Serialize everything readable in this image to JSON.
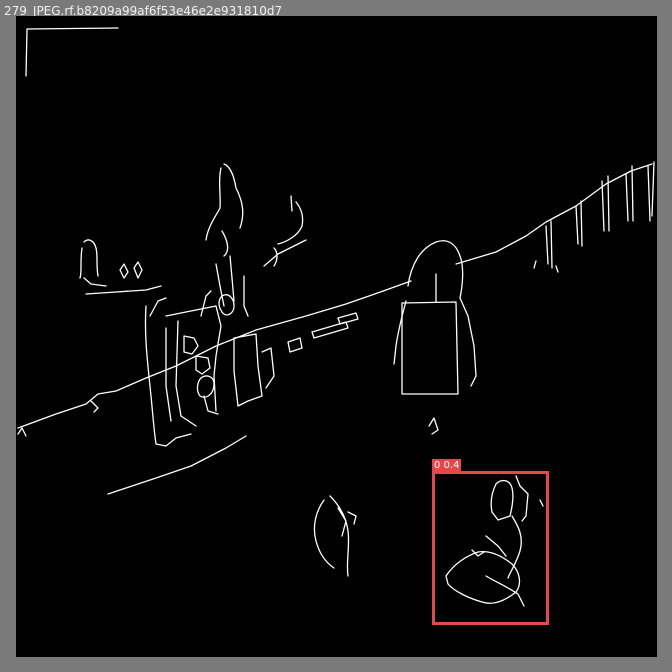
{
  "image": {
    "filename": "279_JPEG.rf.b8209a99af6f53e46e2e931810d7"
  },
  "detections": [
    {
      "label": "0 0.4",
      "color": "#e8474a"
    }
  ],
  "colors": {
    "frame": "#7a7a7a",
    "canvas": "#000000",
    "edges": "#ffffff",
    "box": "#e8474a"
  }
}
